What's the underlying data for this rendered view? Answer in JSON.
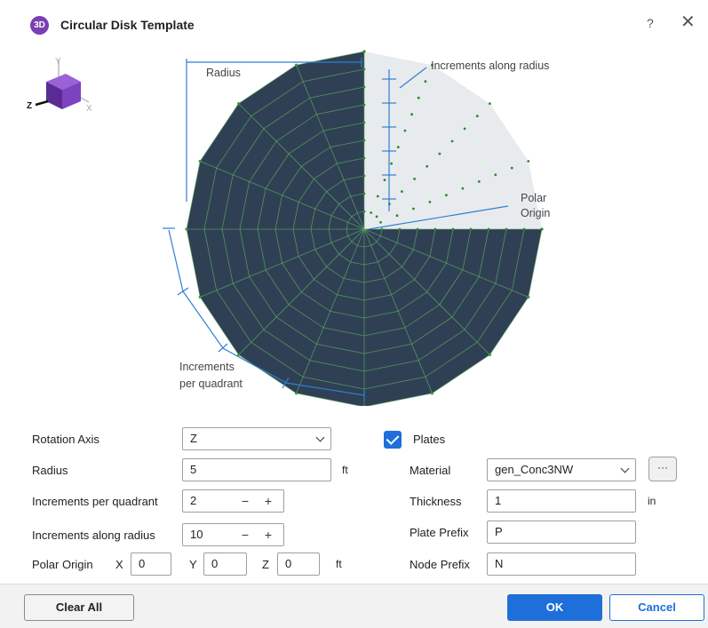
{
  "window": {
    "title": "Circular Disk Template",
    "icon_text": "3D",
    "help_label": "?",
    "close_label": "✕"
  },
  "diagram": {
    "radius_label": "Radius",
    "increments_along_radius_label": "Increments along radius",
    "polar_origin_label_line1": "Polar",
    "polar_origin_label_line2": "Origin",
    "increments_per_quadrant_line1": "Increments",
    "increments_per_quadrant_line2": "per quadrant",
    "axes": {
      "y": "Y",
      "z": "Z",
      "x": "X"
    },
    "colors": {
      "plates": "#2f4055",
      "mesh": "#5fa85f",
      "annotation": "#2f7fd0",
      "unmeshed": "#e8ebee"
    }
  },
  "form": {
    "rotation_axis": {
      "label": "Rotation Axis",
      "value": "Z"
    },
    "radius": {
      "label": "Radius",
      "value": "5",
      "unit": "ft"
    },
    "increments_per_quadrant": {
      "label": "Increments per quadrant",
      "value": "2",
      "minus": "−",
      "plus": "+"
    },
    "increments_along_radius": {
      "label": "Increments along radius",
      "value": "10",
      "minus": "−",
      "plus": "+"
    },
    "polar_origin": {
      "label": "Polar Origin",
      "x_label": "X",
      "x": "0",
      "y_label": "Y",
      "y": "0",
      "z_label": "Z",
      "z": "0",
      "unit": "ft"
    },
    "plates": {
      "label": "Plates",
      "checked": true
    },
    "material": {
      "label": "Material",
      "value": "gen_Conc3NW",
      "browse_label": "···"
    },
    "thickness": {
      "label": "Thickness",
      "value": "1",
      "unit": "in"
    },
    "plate_prefix": {
      "label": "Plate Prefix",
      "value": "P"
    },
    "node_prefix": {
      "label": "Node Prefix",
      "value": "N"
    }
  },
  "footer": {
    "clear_all": "Clear All",
    "ok": "OK",
    "cancel": "Cancel"
  }
}
